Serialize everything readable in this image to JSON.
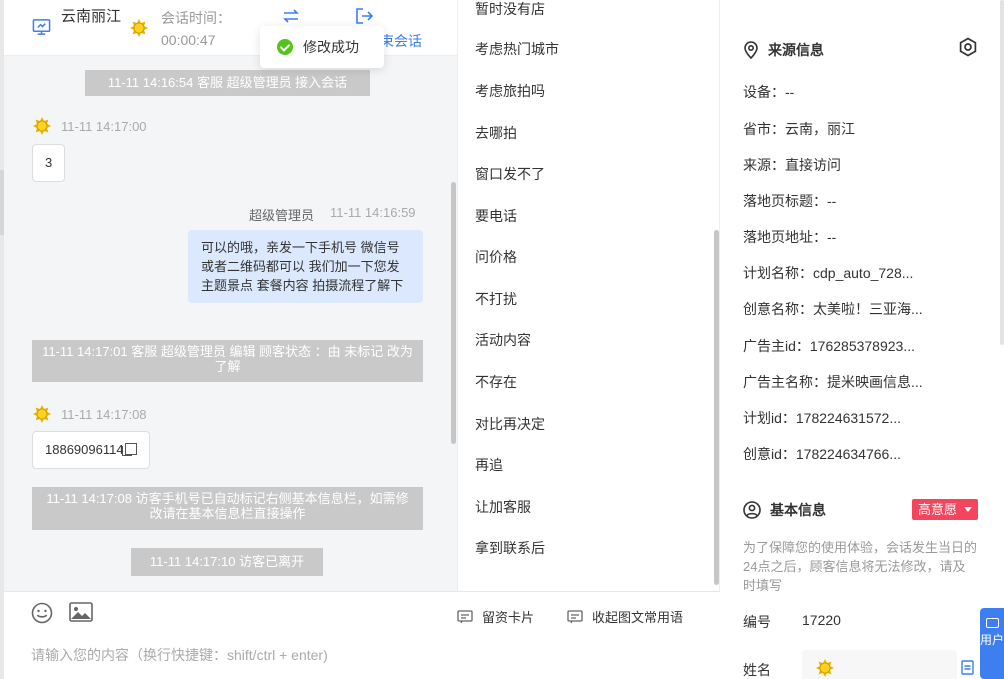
{
  "header": {
    "location": "云南丽江",
    "session_time_label": "会话时间：",
    "session_time_value": "00:00:47",
    "end_label": "束会话"
  },
  "toast": {
    "text": "修改成功"
  },
  "chat": {
    "sys1": "11-11 14:16:54 客服 超级管理员 接入会话",
    "visitor_time1": "11-11 14:17:00",
    "visitor_msg1": "3",
    "agent_name": "超级管理员",
    "agent_time": "11-11 14:16:59",
    "agent_msg": "可以的哦，亲发一下手机号 微信号或者二维码都可以 我们加一下您发主题景点 套餐内容 拍摄流程了解下",
    "sys2": "11-11 14:17:01 客服 超级管理员 编辑 顾客状态 ：由 未标记 改为 了解",
    "visitor_time2": "11-11 14:17:08",
    "visitor_msg2": "18869096114",
    "sys3": "11-11 14:17:08 访客手机号已自动标记右侧基本信息栏，如需修改请在基本信息栏直接操作",
    "sys4": "11-11 14:17:10 访客已离开"
  },
  "input": {
    "card_label": "留资卡片",
    "phrase_label": "收起图文常用语",
    "placeholder": "请输入您的内容（换行快捷键：shift/ctrl + enter)"
  },
  "phrases": [
    "暂时没有店",
    "考虑热门城市",
    "考虑旅拍吗",
    "去哪拍",
    "窗口发不了",
    "要电话",
    "问价格",
    "不打扰",
    "活动内容",
    "不存在",
    "对比再决定",
    "再追",
    "让加客服",
    "拿到联系后"
  ],
  "source": {
    "title": "来源信息",
    "rows": [
      "设备：--",
      "省市：云南，丽江",
      "来源：直接访问",
      "落地页标题：--",
      "落地页地址：--",
      "计划名称：cdp_auto_728...",
      "创意名称：太美啦！三亚海...",
      "广告主id：176285378923...",
      "广告主名称：提米映画信息...",
      "计划id：178224631572...",
      "创意id：178224634766..."
    ]
  },
  "basic": {
    "title": "基本信息",
    "intent": "高意愿",
    "notice": "为了保障您的使用体验，会话发生当日的24点之后，顾客信息将无法修改，请及时填写",
    "id_label": "编号",
    "id_value": "17220",
    "name_label": "姓名"
  },
  "user_tab": "用户"
}
